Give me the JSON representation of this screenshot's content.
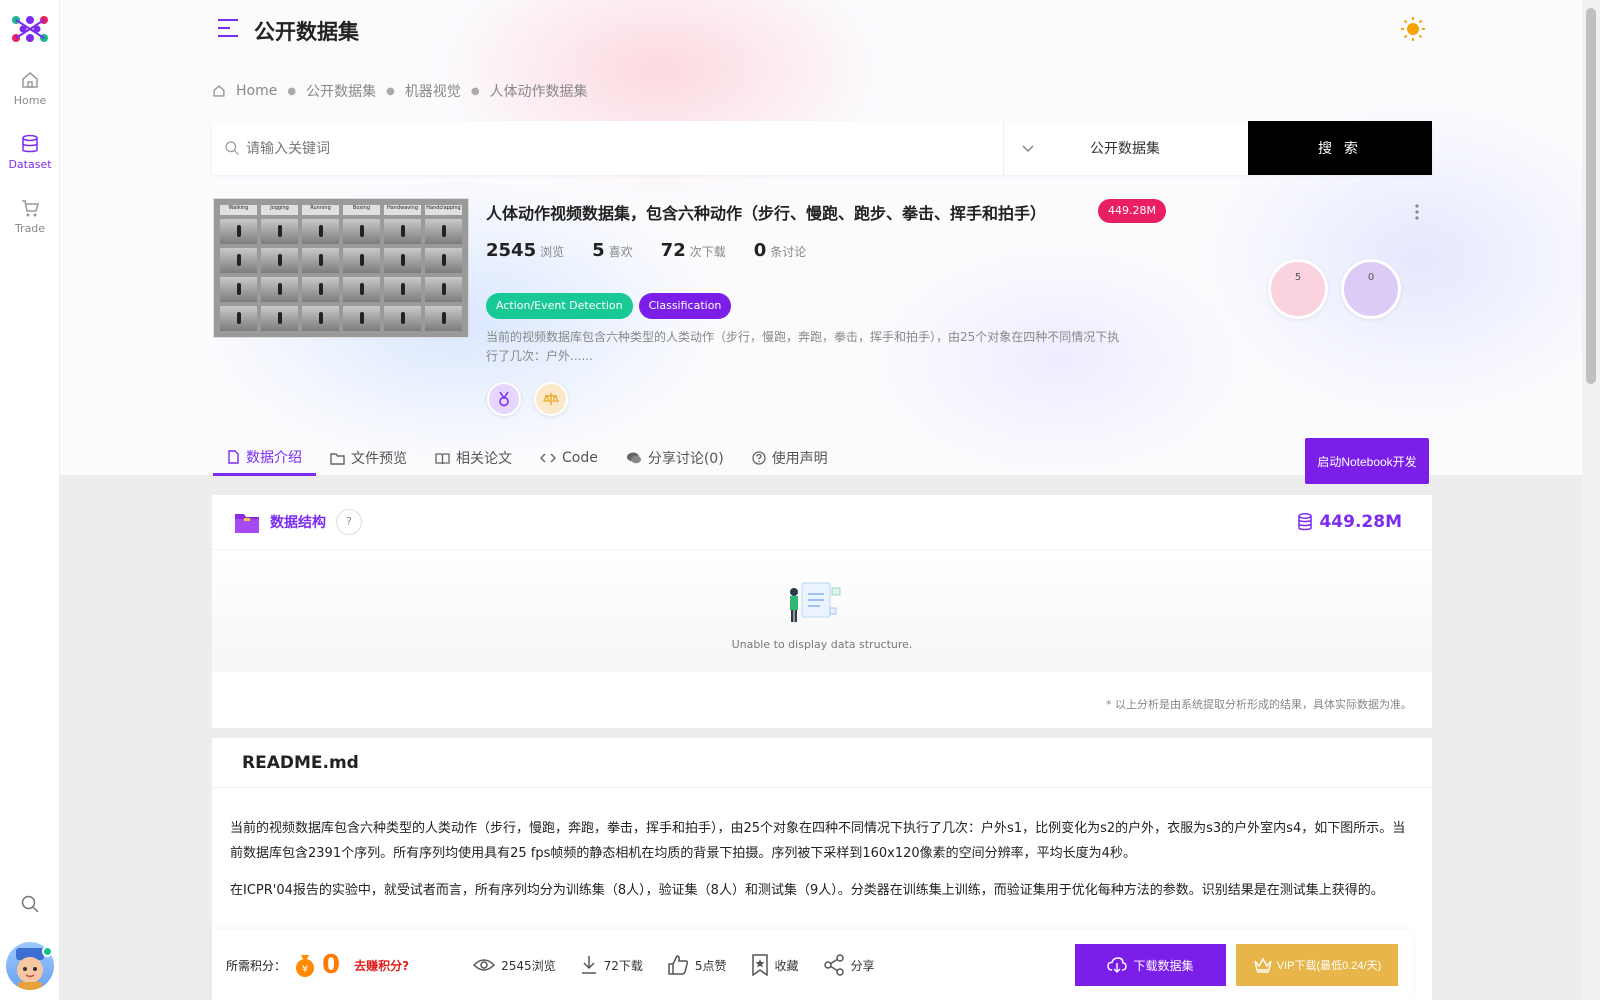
{
  "rail": {
    "items": [
      {
        "label": "Home",
        "icon": "home-icon"
      },
      {
        "label": "Dataset",
        "icon": "database-icon"
      },
      {
        "label": "Trade",
        "icon": "cart-icon"
      }
    ]
  },
  "header": {
    "title": "公开数据集"
  },
  "breadcrumb": [
    "Home",
    "公开数据集",
    "机器视觉",
    "人体动作数据集"
  ],
  "search": {
    "placeholder": "请输入关键词",
    "category": "公开数据集",
    "button": "搜 索"
  },
  "dataset": {
    "title": "人体动作视频数据集，包含六种动作（步行、慢跑、跑步、拳击、挥手和拍手）",
    "size": "449.28M",
    "stats": [
      {
        "value": "2545",
        "unit": "浏览"
      },
      {
        "value": "5",
        "unit": "喜欢"
      },
      {
        "value": "72",
        "unit": "次下载"
      },
      {
        "value": "0",
        "unit": "条讨论"
      }
    ],
    "tags": [
      "Action/Event Detection",
      "Classification"
    ],
    "description": "当前的视频数据库包含六种类型的人类动作（步行，慢跑，奔跑，拳击，挥手和拍手），由25个对象在四种不同情况下执行了几次：户外......",
    "circles": [
      "5",
      "0"
    ],
    "thumb_labels": [
      "Walking",
      "Jogging",
      "Running",
      "Boxing",
      "Handwaving",
      "Handclapping"
    ]
  },
  "tabs": [
    "数据介绍",
    "文件预览",
    "相关论文",
    "Code",
    "分享讨论(0)",
    "使用声明"
  ],
  "notebook_button": "启动Notebook开发",
  "structure": {
    "label": "数据结构",
    "help": "?",
    "size": "449.28M",
    "empty_text": "Unable to display data structure.",
    "note": "* 以上分析是由系统提取分析形成的结果，具体实际数据为准。"
  },
  "readme": {
    "title": "README.md",
    "p1": "当前的视频数据库包含六种类型的人类动作（步行，慢跑，奔跑，拳击，挥手和拍手），由25个对象在四种不同情况下执行了几次：户外s1，比例变化为s2的户外，衣服为s3的户外室内s4，如下图所示。当前数据库包含2391个序列。所有序列均使用具有25 fps帧频的静态相机在均质的背景下拍摄。序列被下采样到160x120像素的空间分辨率，平均长度为4秒。",
    "p2": "在ICPR'04报告的实验中，就受试者而言，所有序列均分为训练集（8人），验证集（8人）和测试集（9人）。分类器在训练集上训练，而验证集用于优化每种方法的参数。识别结果是在测试集上获得的。"
  },
  "footer": {
    "points_label": "所需积分：",
    "points_value": "0",
    "earn": "去赚积分?",
    "views": "2545浏览",
    "downloads": "72下载",
    "likes": "5点赞",
    "favorite": "收藏",
    "share": "分享",
    "download_button": "下载数据集",
    "vip_button": "VIP下载(最低0.24/天)"
  },
  "colors": {
    "accent": "#7b2cf0",
    "accent_button": "#7b1fe8",
    "badge": "#e91e63",
    "tag_green": "#18c996",
    "vip": "#e8b54a"
  }
}
